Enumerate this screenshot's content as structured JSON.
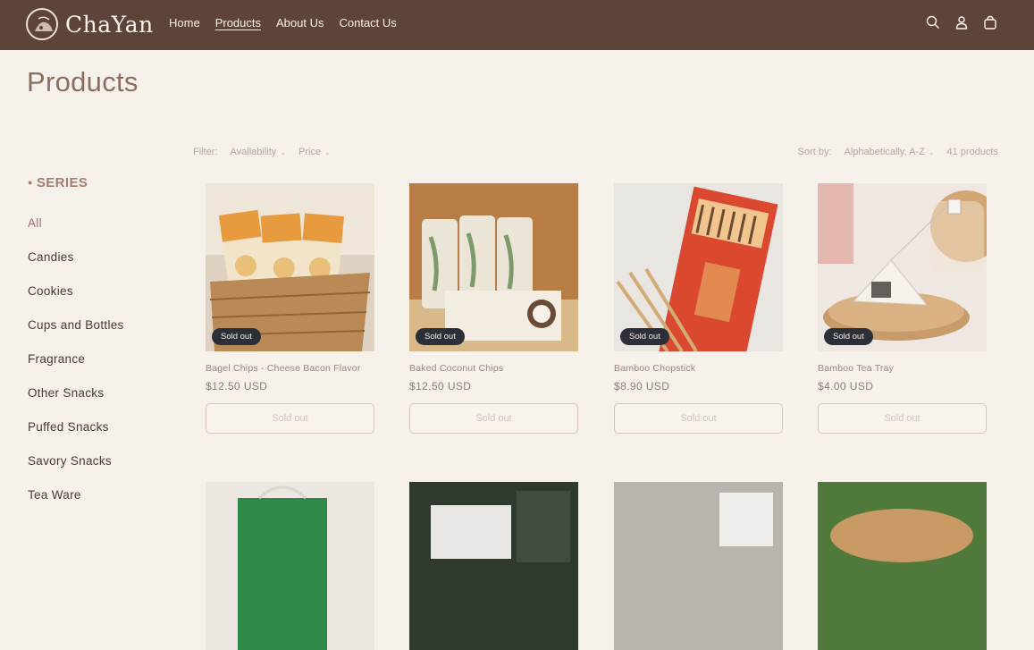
{
  "header": {
    "brand": "ChaYan",
    "nav": [
      {
        "label": "Home"
      },
      {
        "label": "Products",
        "active": true
      },
      {
        "label": "About Us"
      },
      {
        "label": "Contact Us"
      }
    ],
    "icons": [
      "search-icon",
      "account-icon",
      "cart-icon"
    ],
    "bg_color": "#5e4338"
  },
  "page": {
    "title": "Products"
  },
  "filters": {
    "filter_label": "Filter:",
    "availability": "Availability",
    "price": "Price",
    "sort_label": "Sort by:",
    "sort_value": "Alphabetically, A-Z",
    "count": "41 products"
  },
  "sidebar": {
    "title": "SERIES",
    "items": [
      {
        "label": "All",
        "active": true
      },
      {
        "label": "Candies"
      },
      {
        "label": "Cookies"
      },
      {
        "label": "Cups and Bottles"
      },
      {
        "label": "Fragrance"
      },
      {
        "label": "Other Snacks"
      },
      {
        "label": "Puffed Snacks"
      },
      {
        "label": "Savory Snacks"
      },
      {
        "label": "Tea Ware"
      }
    ]
  },
  "products": [
    {
      "name": "Bagel Chips - Cheese Bacon Flavor",
      "price": "$12.50 USD",
      "badge": "Sold out",
      "button": "Sold out"
    },
    {
      "name": "Baked Coconut Chips",
      "price": "$12.50 USD",
      "badge": "Sold out",
      "button": "Sold out"
    },
    {
      "name": "Bamboo Chopstick",
      "price": "$8.90 USD",
      "badge": "Sold out",
      "button": "Sold out"
    },
    {
      "name": "Bamboo Tea Tray",
      "price": "$4.00 USD",
      "badge": "Sold out",
      "button": "Sold out"
    }
  ]
}
